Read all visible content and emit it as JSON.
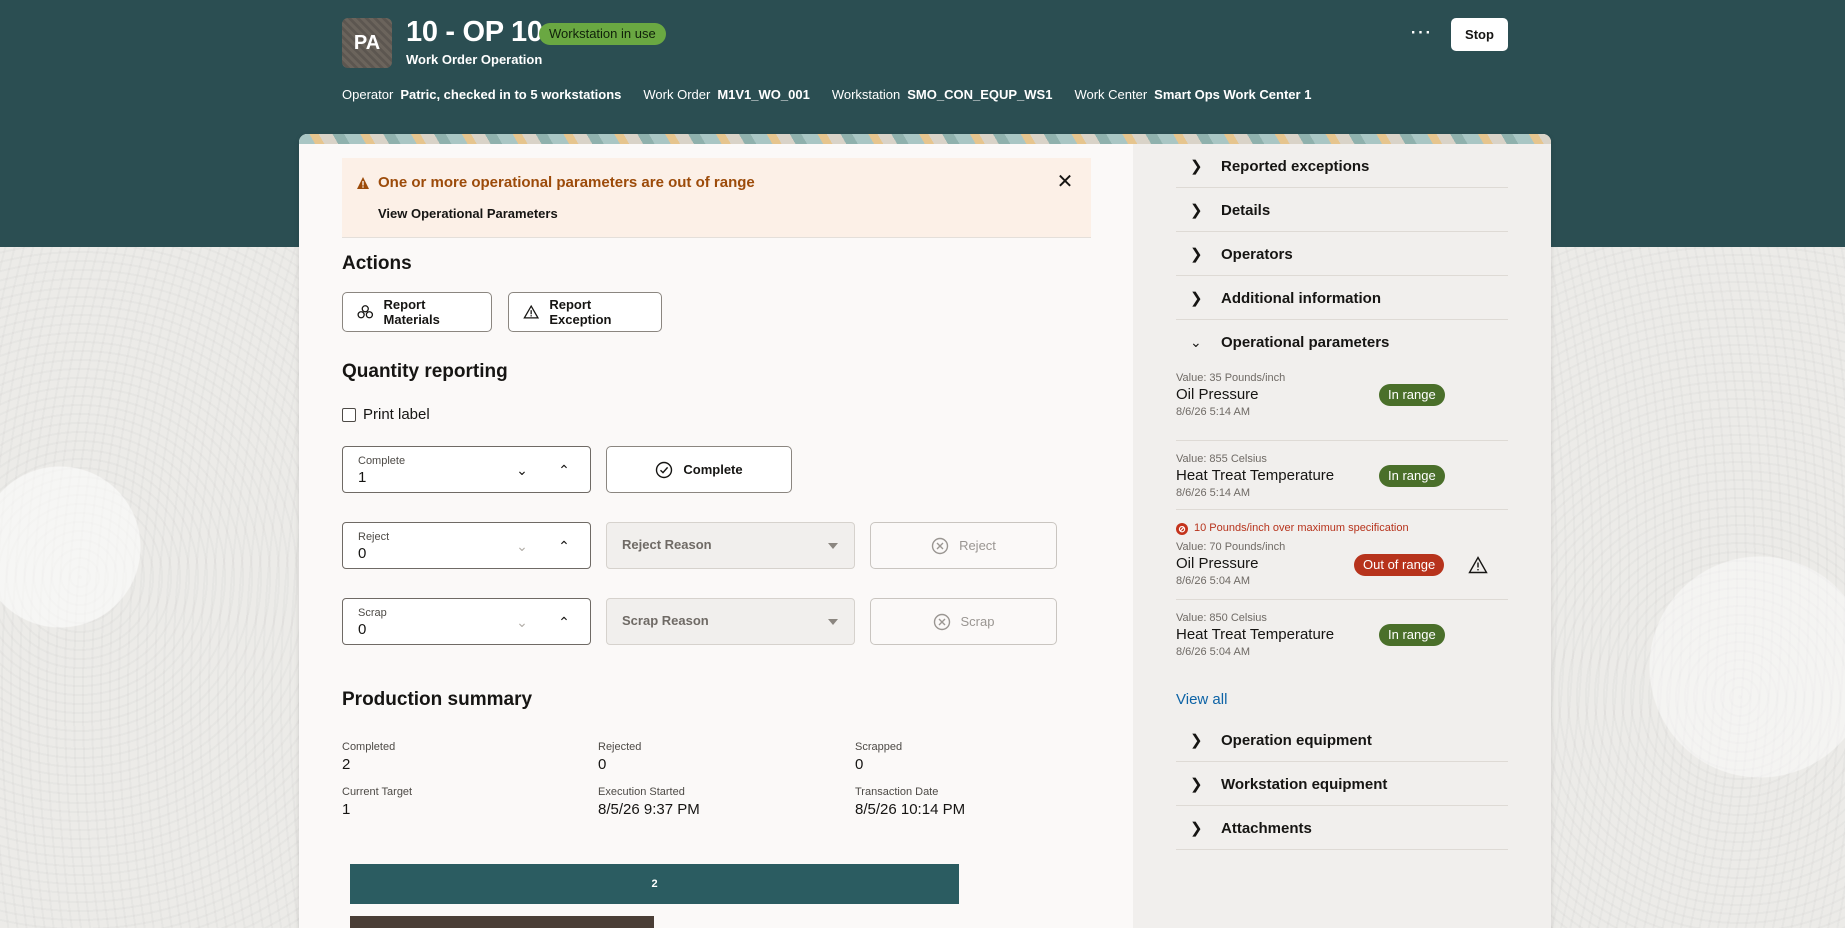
{
  "header": {
    "avatar_initials": "PA",
    "title": "10 - OP 10",
    "status_badge": "Workstation in use",
    "subtitle": "Work Order Operation",
    "more_icon": "⋯",
    "stop_label": "Stop",
    "meta": {
      "operator_label": "Operator",
      "operator_value": "Patric, checked in to 5 workstations",
      "work_order_label": "Work Order",
      "work_order_value": "M1V1_WO_001",
      "workstation_label": "Workstation",
      "workstation_value": "SMO_CON_EQUP_WS1",
      "work_center_label": "Work Center",
      "work_center_value": "Smart Ops Work Center 1"
    }
  },
  "alert": {
    "title": "One or more operational parameters are out of range",
    "link": "View Operational Parameters",
    "close_icon": "✕"
  },
  "actions": {
    "heading": "Actions",
    "report_materials": "Report Materials",
    "report_exception": "Report Exception"
  },
  "quantity": {
    "heading": "Quantity reporting",
    "print_label": "Print label",
    "complete": {
      "label": "Complete",
      "value": "1",
      "button": "Complete"
    },
    "reject": {
      "label": "Reject",
      "value": "0",
      "reason_placeholder": "Reject Reason",
      "button": "Reject"
    },
    "scrap": {
      "label": "Scrap",
      "value": "0",
      "reason_placeholder": "Scrap Reason",
      "button": "Scrap"
    }
  },
  "summary": {
    "heading": "Production summary",
    "completed_label": "Completed",
    "completed_value": "2",
    "rejected_label": "Rejected",
    "rejected_value": "0",
    "scrapped_label": "Scrapped",
    "scrapped_value": "0",
    "target_label": "Current Target",
    "target_value": "1",
    "started_label": "Execution Started",
    "started_value": "8/5/26 9:37 PM",
    "txn_label": "Transaction Date",
    "txn_value": "8/5/26 10:14 PM",
    "bar_value": "2"
  },
  "sidebar": {
    "sections_top": [
      {
        "label": "Reported exceptions"
      },
      {
        "label": "Details"
      },
      {
        "label": "Operators"
      },
      {
        "label": "Additional information"
      }
    ],
    "open_section": "Operational parameters",
    "params": [
      {
        "value": "Value: 35 Pounds/inch",
        "name": "Oil Pressure",
        "date": "8/6/26 5:14 AM",
        "status": "In range"
      },
      {
        "value": "Value: 855 Celsius",
        "name": "Heat Treat Temperature",
        "date": "8/6/26 5:14 AM",
        "status": "In range"
      },
      {
        "error": "10 Pounds/inch over maximum specification",
        "value": "Value: 70 Pounds/inch",
        "name": "Oil Pressure",
        "date": "8/6/26 5:04 AM",
        "status": "Out of range"
      },
      {
        "value": "Value: 850 Celsius",
        "name": "Heat Treat Temperature",
        "date": "8/6/26 5:04 AM",
        "status": "In range"
      }
    ],
    "view_all": "View all",
    "sections_bottom": [
      {
        "label": "Operation equipment"
      },
      {
        "label": "Workstation equipment"
      },
      {
        "label": "Attachments"
      }
    ]
  },
  "colors": {
    "header": "#2b4e52",
    "in_range": "#4a6f2a",
    "out_of_range": "#b7331c",
    "alert_text": "#9c4b0a"
  }
}
